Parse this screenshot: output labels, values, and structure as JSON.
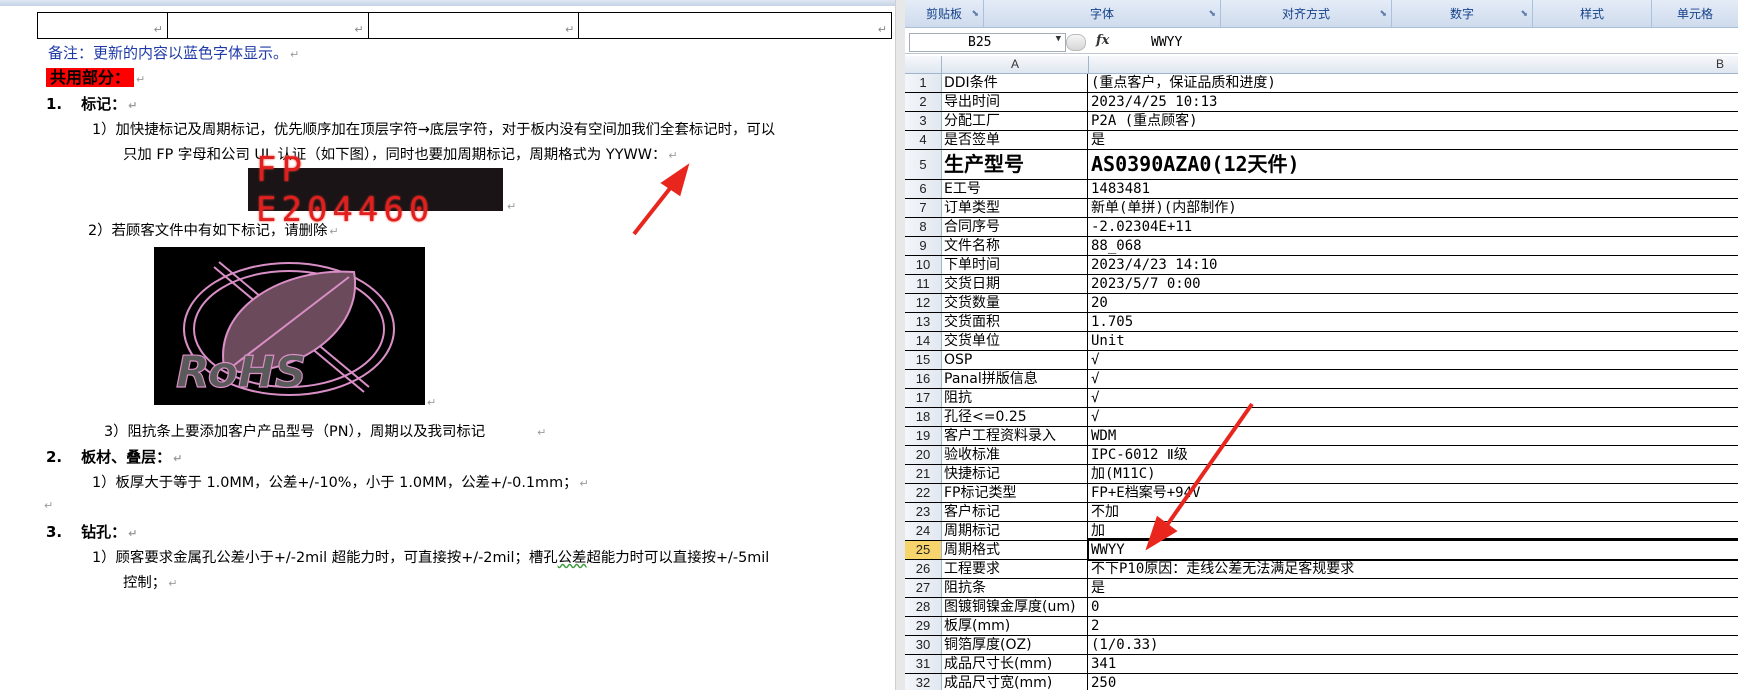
{
  "doc": {
    "note": "备注：更新的内容以蓝色字体显示。",
    "shared_title": "共用部分：",
    "sec1_num": "1.",
    "sec1_title": "标记：",
    "item1_line1": "1）加快捷标记及周期标记，优先顺序加在顶层字符→底层字符，对于板内没有空间加我们全套标记时，可以",
    "item1_line2": "只加 FP 字母和公司 UL 认证（如下图），同时也要加周期标记，周期格式为 YYWW：",
    "marking_text": "FP E204460",
    "item2": "2）若顾客文件中有如下标记，请删除",
    "rohs_text": "RoHS",
    "item3": "3）阻抗条上要添加客户产品型号（PN），周期以及我司标记",
    "sec2_num": "2.",
    "sec2_title": "板材、叠层：",
    "sec2_item1": "1）板厚大于等于 1.0MM，公差+/-10%，小于 1.0MM，公差+/-0.1mm；",
    "sec3_num": "3.",
    "sec3_title": "钻孔：",
    "sec3_item1_line1": "1）顾客要求金属孔公差小于+/-2mil  超能力时，可直接按+/-2mil；槽孔",
    "sec3_item1_word": "公差",
    "sec3_item1_line1b": "超能力时可以直接按+/-5mil",
    "sec3_item1_line2": "控制；",
    "para_mark": "↵"
  },
  "excel": {
    "ribbon": [
      "剪贴板",
      "字体",
      "对齐方式",
      "数字",
      "样式",
      "单元格"
    ],
    "namebox": "B25",
    "fx": "fx",
    "formula": "WWYY",
    "columns": [
      "A",
      "B"
    ],
    "rows": [
      {
        "n": "1",
        "a": "DDI条件",
        "b": "(重点客户，保证品质和进度)"
      },
      {
        "n": "2",
        "a": "导出时间",
        "b": "2023/4/25 10:13"
      },
      {
        "n": "3",
        "a": "分配工厂",
        "b": "P2A (重点顾客)"
      },
      {
        "n": "4",
        "a": "是否签单",
        "b": "是"
      },
      {
        "n": "5",
        "a": "生产型号",
        "b": "AS0390AZA0(12天件)"
      },
      {
        "n": "6",
        "a": "E工号",
        "b": "1483481"
      },
      {
        "n": "7",
        "a": "订单类型",
        "b": "新单(单拼)(内部制作)"
      },
      {
        "n": "8",
        "a": "合同序号",
        "b": "-2.02304E+11"
      },
      {
        "n": "9",
        "a": "文件名称",
        "b": "88_068"
      },
      {
        "n": "10",
        "a": "下单时间",
        "b": "2023/4/23 14:10"
      },
      {
        "n": "11",
        "a": "交货日期",
        "b": "2023/5/7 0:00"
      },
      {
        "n": "12",
        "a": "交货数量",
        "b": "20"
      },
      {
        "n": "13",
        "a": "交货面积",
        "b": "1.705"
      },
      {
        "n": "14",
        "a": "交货单位",
        "b": "Unit"
      },
      {
        "n": "15",
        "a": "OSP",
        "b": " √"
      },
      {
        "n": "16",
        "a": "Panal拼版信息",
        "b": " √"
      },
      {
        "n": "17",
        "a": "阻抗",
        "b": " √"
      },
      {
        "n": "18",
        "a": "孔径<=0.25",
        "b": " √"
      },
      {
        "n": "19",
        "a": "客户工程资料录入",
        "b": "WDM"
      },
      {
        "n": "20",
        "a": "验收标准",
        "b": "IPC-6012 Ⅱ级"
      },
      {
        "n": "21",
        "a": "快捷标记",
        "b": "加(M11C)"
      },
      {
        "n": "22",
        "a": "FP标记类型",
        "b": "FP+E档案号+94V"
      },
      {
        "n": "23",
        "a": "客户标记",
        "b": "不加"
      },
      {
        "n": "24",
        "a": "周期标记",
        "b": "加"
      },
      {
        "n": "25",
        "a": "周期格式",
        "b": "WWYY"
      },
      {
        "n": "26",
        "a": "工程要求",
        "b": "不下P10原因：走线公差无法满足客规要求"
      },
      {
        "n": "27",
        "a": "阻抗条",
        "b": "是"
      },
      {
        "n": "28",
        "a": "图镀铜镍金厚度(um)",
        "b": "0"
      },
      {
        "n": "29",
        "a": "板厚(mm)",
        "b": "2"
      },
      {
        "n": "30",
        "a": "铜箔厚度(OZ)",
        "b": "(1/0.33)"
      },
      {
        "n": "31",
        "a": "成品尺寸长(mm)",
        "b": "341"
      },
      {
        "n": "32",
        "a": "成品尺寸宽(mm)",
        "b": "250"
      }
    ]
  },
  "colors": {
    "arrow": "#e8261e",
    "note_blue": "#1f3aa8",
    "highlight_red": "#ff0000",
    "marking_red": "#e0201e"
  }
}
